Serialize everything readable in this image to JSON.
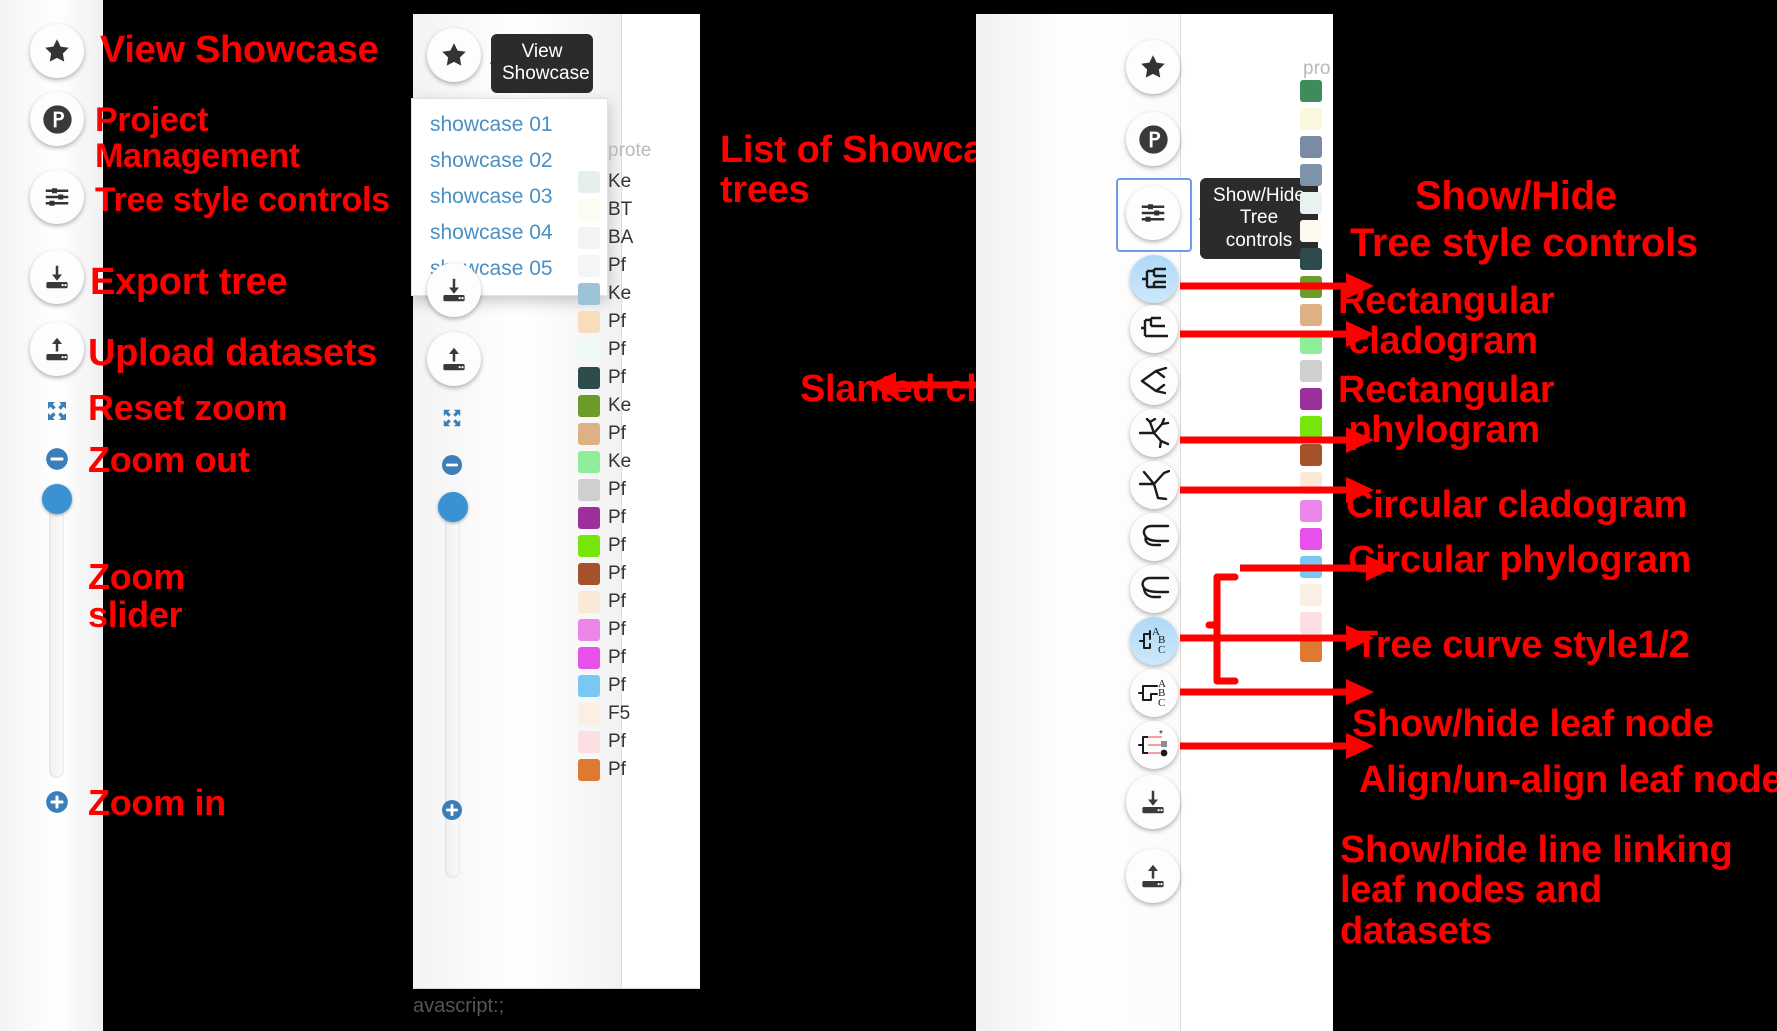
{
  "left_panel": {
    "buttons": [
      {
        "icon": "star-icon",
        "label": "View Showcase"
      },
      {
        "icon": "project-p-icon",
        "label": "Project\nManagement"
      },
      {
        "icon": "sliders-icon",
        "label": "Tree style controls"
      },
      {
        "icon": "download-tray-icon",
        "label": "Export tree"
      },
      {
        "icon": "upload-tray-icon",
        "label": "Upload datasets"
      }
    ],
    "zoom_controls": [
      {
        "icon": "expand-arrows-icon",
        "label": "Reset zoom"
      },
      {
        "icon": "minus-circle-icon",
        "label": "Zoom out"
      },
      {
        "icon": "zoom-slider",
        "label": "Zoom\nslider"
      },
      {
        "icon": "plus-circle-icon",
        "label": "Zoom in"
      }
    ]
  },
  "middle_panel": {
    "tooltip": "View\nShowcase",
    "showcase_items": [
      "showcase 01",
      "showcase 02",
      "showcase 03",
      "showcase 04",
      "showcase 05"
    ],
    "annotation": "List of Showcase\ntrees",
    "legend_header": "prote",
    "legend_rows": [
      {
        "color": "#e4f0e9",
        "label": "Ke"
      },
      {
        "color": "#fdfcf0",
        "label": "BT"
      },
      {
        "color": "#f2f3f5",
        "label": "BA"
      },
      {
        "color": "#f3f5f7",
        "label": "Pf"
      },
      {
        "color": "#9cc4d6",
        "label": "Ke"
      },
      {
        "color": "#f8dcbc",
        "label": "Pf"
      },
      {
        "color": "#eefaf4",
        "label": "Pf"
      },
      {
        "color": "#2d4b4d",
        "label": "Pf"
      },
      {
        "color": "#6d9b29",
        "label": "Ke"
      },
      {
        "color": "#ddb184",
        "label": "Pf"
      },
      {
        "color": "#90ed9a",
        "label": "Ke"
      },
      {
        "color": "#cfcfcf",
        "label": "Pf"
      },
      {
        "color": "#9c2f9c",
        "label": "Pf"
      },
      {
        "color": "#76e509",
        "label": "Pf"
      },
      {
        "color": "#a5522a",
        "label": "Pf"
      },
      {
        "color": "#fbe9d7",
        "label": "Pf"
      },
      {
        "color": "#eb85e8",
        "label": "Pf"
      },
      {
        "color": "#e850ea",
        "label": "Pf"
      },
      {
        "color": "#79c8f4",
        "label": "Pf"
      },
      {
        "color": "#fbeee3",
        "label": "F5"
      },
      {
        "color": "#fbdfe2",
        "label": "Pf"
      },
      {
        "color": "#e07830",
        "label": "Pf"
      }
    ],
    "status_text": "avascript:;"
  },
  "right_panel": {
    "tooltip": "Show/Hide\nTree\ncontrols",
    "legend_header": "pro",
    "toolbar_icons": [
      {
        "icon": "star-icon"
      },
      {
        "icon": "project-p-icon"
      },
      {
        "icon": "sliders-icon"
      },
      {
        "icon": "rect-cladogram-icon"
      },
      {
        "icon": "rect-phylogram-icon"
      },
      {
        "icon": "slanted-cladogram-icon"
      },
      {
        "icon": "circular-cladogram-icon"
      },
      {
        "icon": "circular-phylogram-icon"
      },
      {
        "icon": "tree-curve-style1-icon"
      },
      {
        "icon": "tree-curve-style2-icon"
      },
      {
        "icon": "show-hide-leaf-node-icon"
      },
      {
        "icon": "align-leaf-node-icon"
      },
      {
        "icon": "show-hide-link-line-icon"
      },
      {
        "icon": "download-tray-icon"
      },
      {
        "icon": "upload-tray-icon"
      }
    ],
    "annotations": [
      "Show/Hide",
      "Tree style controls",
      "Rectangular\n cladogram",
      "Rectangular\n phylogram",
      "Circular cladogram",
      "Circular phylogram",
      "Tree curve style1/2",
      "Show/hide leaf node",
      " Align/un-align leaf node",
      "Show/hide line linking\nleaf nodes and\ndatasets"
    ],
    "swatch_colors": [
      "#3d8c5a",
      "#fbf8e0",
      "#7a8ba3",
      "#7d93a8",
      "#e8f3ef",
      "#fdfbf0",
      "#2d4b4d",
      "#6d9b29",
      "#ddb184",
      "#90ed9a",
      "#cfcfcf",
      "#9c2f9c",
      "#76e509",
      "#a5522a",
      "#fbe9d7",
      "#eb85e8",
      "#e850ea",
      "#79c8f4",
      "#fbeee3",
      "#fbdfe2",
      "#e07830"
    ]
  },
  "colors": {
    "annotation_red": "#ff0000",
    "link_blue": "#4a90c4",
    "selection_blue": "#6f9ce8",
    "slider_blue": "#3a92d2"
  }
}
